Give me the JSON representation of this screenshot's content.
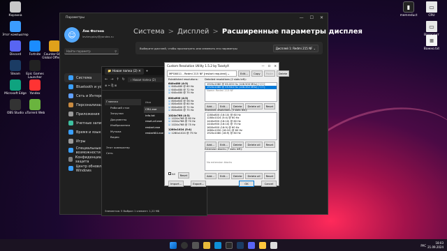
{
  "desktop": {
    "icons": [
      {
        "label": "Корзина",
        "x": 0,
        "y": 0,
        "color": "#c8c8c8"
      },
      {
        "label": "Этот компьютер",
        "x": 0,
        "y": 1,
        "color": "#3b9cff"
      },
      {
        "label": "Discord",
        "x": 0,
        "y": 2,
        "color": "#5865f2"
      },
      {
        "label": "Fortnite",
        "x": 1,
        "y": 2,
        "color": "#1b8cff"
      },
      {
        "label": "Counter-Strike Global Offensive",
        "x": 2,
        "y": 2,
        "color": "#e0a11b"
      },
      {
        "label": "Steam",
        "x": 0,
        "y": 3,
        "color": "#1b3c64"
      },
      {
        "label": "Epic Games Launcher",
        "x": 1,
        "y": 3,
        "color": "#222"
      },
      {
        "label": "Microsoft Edge",
        "x": 0,
        "y": 4,
        "color": "#0fa37f"
      },
      {
        "label": "Yandex",
        "x": 1,
        "y": 4,
        "color": "#ff3333"
      },
      {
        "label": "OBS Studio",
        "x": 0,
        "y": 5,
        "color": "#333"
      },
      {
        "label": "uTorrent Web",
        "x": 1,
        "y": 5,
        "color": "#6ab43e"
      }
    ],
    "right_icons": [
      {
        "label": "memreduct"
      },
      {
        "label": "CRU"
      },
      {
        "label": "Валорант"
      },
      {
        "label": "Важно.txt"
      }
    ]
  },
  "settings": {
    "title": "Параметры",
    "user_name": "Лев Фатеев",
    "user_email": "levkmyplay@yandex.ru",
    "search_placeholder": "Найти параметр",
    "breadcrumb": [
      "Система",
      ">",
      "Дисплей",
      ">",
      "Расширенные параметры дисплея"
    ],
    "select_text": "Выберите дисплей, чтобы просмотреть или изменить его параметры",
    "display_value": "Дисплей 1: Redmi 215 NF",
    "nav": [
      "Система",
      "Bluetooth и устройства",
      "Сеть и Интернет",
      "Персонализация",
      "Приложения",
      "Учетные записи",
      "Время и язык",
      "Игры",
      "Специальные возможности",
      "Конфиденциальность и защита",
      "Центр обновления Windows"
    ],
    "nav_colors": [
      "#3aa0ff",
      "#3aa0ff",
      "#60a0ff",
      "#c88a40",
      "#9a9a9a",
      "#3ec0a0",
      "#3aa0ff",
      "#9a9a9a",
      "#3aa0ff",
      "#808080",
      "#3aa0ff"
    ]
  },
  "explorer": {
    "tab": "Новая папка (2)",
    "path": "Новая папка (2)",
    "left": [
      "Главная",
      "Рабочий стол",
      "Загрузки",
      "Документы",
      "Изображения",
      "Музыка",
      "Видео",
      "Этот компьютер",
      "Сеть"
    ],
    "col_header": "Имя",
    "files": [
      "CRU.exe",
      "info.txt",
      "reset-all.exe",
      "restart.exe",
      "restart64.exe"
    ],
    "status": "Элементов: 5   Выбран 1 элемент: 1,22 МБ"
  },
  "cru": {
    "title": "Custom Resolution Utility 1.5.2 by ToastyX",
    "monitor": "MPG6011 - Redmi 215 NF [restart required]",
    "top_buttons": [
      "Edit...",
      "Copy",
      "Paste",
      "Delete"
    ],
    "established_label": "Established resolutions:",
    "detailed_label": "Detailed resolutions (2 slots left):",
    "detailed": [
      "1920x1080 @ 60.000 Hz (148.500 MHz) [+/+]",
      "1920x1080 @ 59.940 Hz (148.352 MHz) [+/+]"
    ],
    "name_line": "Name: Redmi 215 NF",
    "established": [
      "640x480 (4:3)",
      "640x480 @ 60 Hz",
      "640x480 @ 72 Hz",
      "640x480 @ 75 Hz",
      "800x600 (4:3)",
      "800x600 @ 56 Hz",
      "800x600 @ 60 Hz",
      "800x600 @ 72 Hz",
      "800x600 @ 75 Hz",
      "1024x768 (4:3)",
      "1024x768 @ 60 Hz",
      "1024x768 @ 70 Hz",
      "1024x768 @ 75 Hz",
      "1280x1024 (5:4)",
      "1280x1024 @ 75 Hz"
    ],
    "standard_label": "Standard resolutions (3 slots left):",
    "standard": [
      "1280x800 (16:10) @ 60 Hz",
      "1280x1024 (5:4) @ 60 Hz",
      "1440x900 (16:10) @ 60 Hz",
      "1440x900 (16:10) @ 75 Hz",
      "1600x900 (16:9) @ 60 Hz",
      "1680x1050 (16:10) @ 60 Hz",
      "1920x1080 (16:9) @ 60 Hz"
    ],
    "extension_label": "Extension blocks (7 slots left):",
    "extension_text": "No extension blocks",
    "row_buttons": [
      "Add...",
      "Edit...",
      "Delete",
      "Delete all",
      "Reset"
    ],
    "bottom": [
      "Import...",
      "Export...",
      "OK",
      "Cancel"
    ],
    "checkbox": "All"
  },
  "taskbar": {
    "lang": "РУС",
    "time": "18:03",
    "date": "21.09.2024"
  },
  "colors": {
    "accent": "#0078d4",
    "select": "#0078d7"
  }
}
